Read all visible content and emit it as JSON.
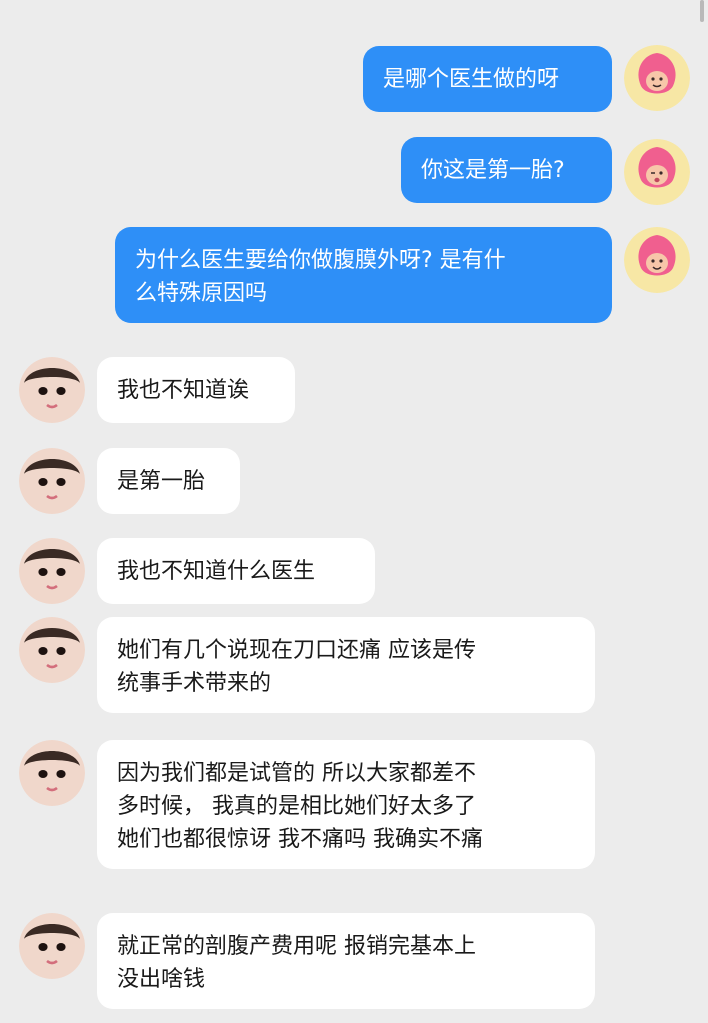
{
  "chat": {
    "colors": {
      "background": "#ececec",
      "sent_bubble": "#2e8ff7",
      "received_bubble": "#ffffff"
    },
    "sent_messages": [
      {
        "text": "是哪个医生做的呀"
      },
      {
        "text": "你这是第一胎?"
      },
      {
        "text": "为什么医生要给你做腹膜外呀? 是有什\n么特殊原因吗"
      }
    ],
    "received_messages": [
      {
        "text": "我也不知道诶"
      },
      {
        "text": "是第一胎"
      },
      {
        "text": "我也不知道什么医生"
      },
      {
        "text": "她们有几个说现在刀口还痛 应该是传\n统事手术带来的"
      },
      {
        "text": "因为我们都是试管的 所以大家都差不\n多时候， 我真的是相比她们好太多了\n她们也都很惊讶 我不痛吗 我确实不痛"
      },
      {
        "text": "就正常的剖腹产费用呢 报销完基本上\n没出啥钱"
      }
    ],
    "avatars": {
      "self": "cartoon-peach-avatar",
      "other": "baby-face-avatar"
    }
  }
}
